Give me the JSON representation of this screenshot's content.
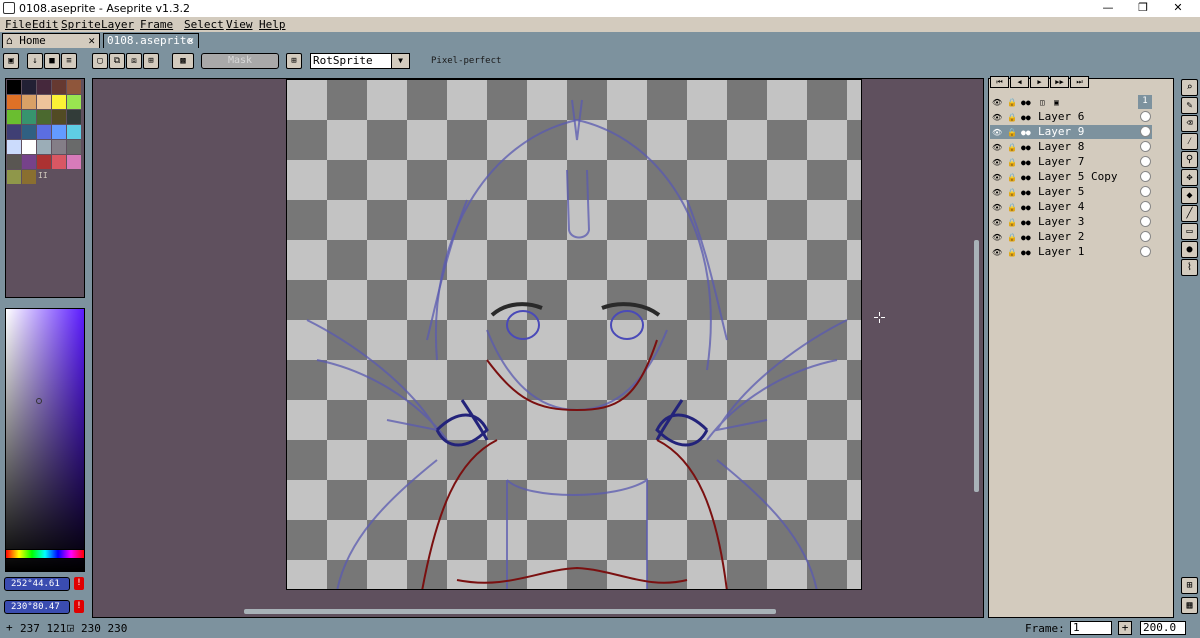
{
  "window": {
    "title": "0108.aseprite - Aseprite v1.3.2",
    "minimize": "—",
    "maximize": "❐",
    "close": "✕"
  },
  "menu": [
    "File",
    "Edit",
    "Sprite",
    "Layer",
    "Frame",
    "Select",
    "View",
    "Help"
  ],
  "tabs": [
    {
      "label": "Home",
      "close": "✕"
    },
    {
      "label": "0108.aseprite",
      "close": "✕"
    }
  ],
  "toolbar": {
    "mask_label": "Mask",
    "rotation_algorithm": "RotSprite",
    "pixel_perfect_label": "Pixel-perfect"
  },
  "palette": {
    "colors": [
      "#000000",
      "#222034",
      "#45283c",
      "#663931",
      "#8f563b",
      "#df7126",
      "#d9a066",
      "#eec39a",
      "#fbf236",
      "#99e550",
      "#6abe30",
      "#37946e",
      "#4b692f",
      "#524b24",
      "#323c39",
      "#3f3f74",
      "#306082",
      "#5b6ee1",
      "#639bff",
      "#5fcde4",
      "#cbdbfc",
      "#ffffff",
      "#9badb7",
      "#847e87",
      "#696a6a",
      "#595652",
      "#76428a",
      "#ac3232",
      "#d95763",
      "#d77bba",
      "#8f974a",
      "#8a6f30"
    ]
  },
  "color_fields": {
    "foreground": "252°44.61",
    "background": "230°80.47",
    "warn": "!"
  },
  "layers": [
    {
      "name": "Layer 6",
      "active": false
    },
    {
      "name": "Layer 9",
      "active": true
    },
    {
      "name": "Layer 8",
      "active": false
    },
    {
      "name": "Layer 7",
      "active": false
    },
    {
      "name": "Layer 5 Copy",
      "active": false
    },
    {
      "name": "Layer 5",
      "active": false
    },
    {
      "name": "Layer 4",
      "active": false
    },
    {
      "name": "Layer 3",
      "active": false
    },
    {
      "name": "Layer 2",
      "active": false
    },
    {
      "name": "Layer 1",
      "active": false
    }
  ],
  "timeline_frame_number": "1",
  "status": {
    "cursor_pos": "237 121",
    "sprite_size": "230 230",
    "frame_label": "Frame:",
    "frame_value": "1",
    "zoom_value": "200.0",
    "plus": "+"
  }
}
